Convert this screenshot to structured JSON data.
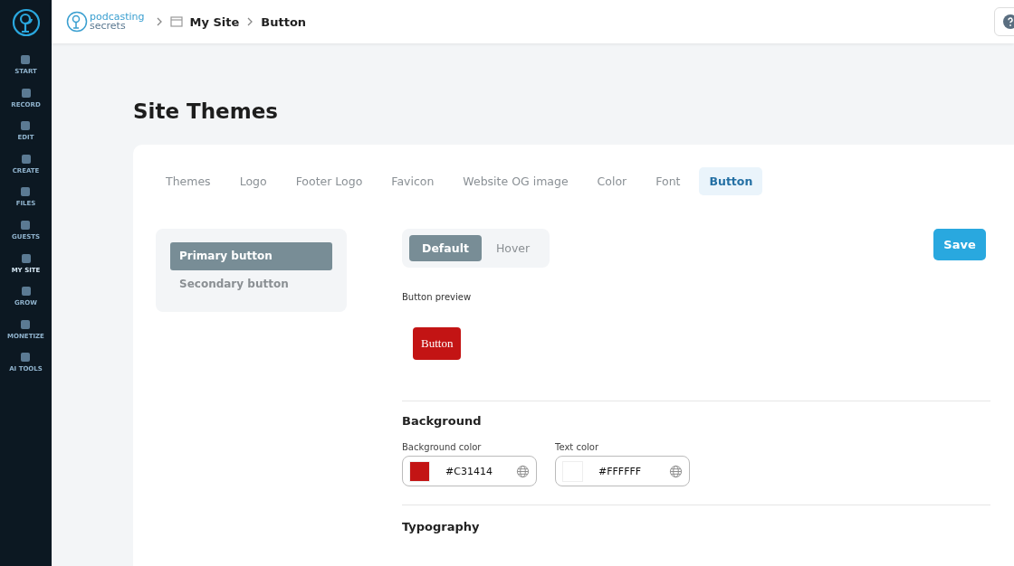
{
  "nav": [
    {
      "label": "START",
      "selected": false
    },
    {
      "label": "RECORD",
      "selected": false
    },
    {
      "label": "EDIT",
      "selected": false
    },
    {
      "label": "CREATE",
      "selected": false
    },
    {
      "label": "FILES",
      "selected": false
    },
    {
      "label": "GUESTS",
      "selected": false
    },
    {
      "label": "MY SITE",
      "selected": true
    },
    {
      "label": "GROW",
      "selected": false
    },
    {
      "label": "MONETIZE",
      "selected": false
    },
    {
      "label": "AI TOOLS",
      "selected": false
    }
  ],
  "brand": {
    "line1": "podcasting",
    "line2": "secrets"
  },
  "breadcrumb": [
    "My Site",
    "Button"
  ],
  "page_title": "Site Themes",
  "tabs": [
    {
      "label": "Themes",
      "selected": false
    },
    {
      "label": "Logo",
      "selected": false
    },
    {
      "label": "Footer Logo",
      "selected": false
    },
    {
      "label": "Favicon",
      "selected": false
    },
    {
      "label": "Website OG image",
      "selected": false
    },
    {
      "label": "Color",
      "selected": false
    },
    {
      "label": "Font",
      "selected": false
    },
    {
      "label": "Button",
      "selected": true
    }
  ],
  "button_types": [
    {
      "label": "Primary button",
      "selected": true
    },
    {
      "label": "Secondary button",
      "selected": false
    }
  ],
  "states": [
    {
      "label": "Default",
      "selected": true
    },
    {
      "label": "Hover",
      "selected": false
    }
  ],
  "save": "Save",
  "preview": {
    "label": "Button preview",
    "button": "Button"
  },
  "background": {
    "heading": "Background",
    "fields": [
      {
        "label": "Background color",
        "value": "#C31414",
        "color": "#c31414"
      },
      {
        "label": "Text color",
        "value": "#FFFFFF",
        "color": "#ffffff"
      }
    ]
  },
  "typography": {
    "heading": "Typography"
  }
}
